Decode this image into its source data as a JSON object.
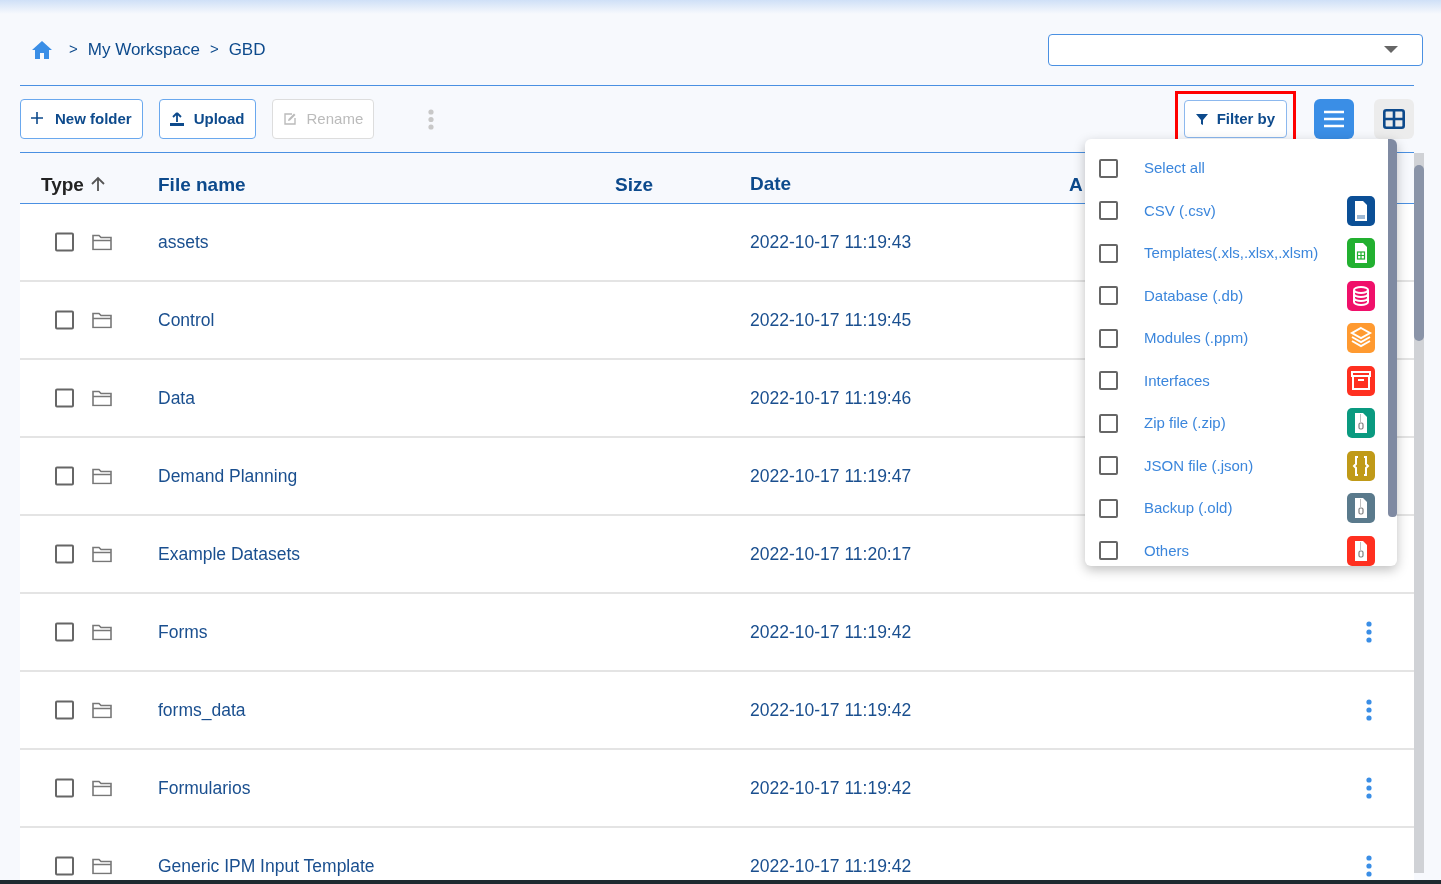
{
  "breadcrumb": [
    "My Workspace",
    "GBD"
  ],
  "breadcrumb_separator": ">",
  "toolbar": {
    "buttons": [
      {
        "label": "New folder",
        "kind": "add",
        "disabled": false
      },
      {
        "label": "Upload",
        "kind": "upload",
        "disabled": false
      },
      {
        "label": "Rename",
        "kind": "rename",
        "disabled": true
      }
    ],
    "filter": {
      "label": "Filter by",
      "highlighted": true
    },
    "views": [
      {
        "kind": "list",
        "selected": true
      },
      {
        "kind": "grid",
        "selected": false
      }
    ]
  },
  "table": {
    "columns": [
      "Type",
      "File name",
      "Size",
      "Date",
      "A"
    ],
    "sort_ascending": true,
    "rows": [
      {
        "name": "assets",
        "date": "2022-10-17 11:19:43",
        "checked": false,
        "menu": false
      },
      {
        "name": "Control",
        "date": "2022-10-17 11:19:45",
        "checked": false,
        "menu": false
      },
      {
        "name": "Data",
        "date": "2022-10-17 11:19:46",
        "checked": false,
        "menu": false
      },
      {
        "name": "Demand Planning",
        "date": "2022-10-17 11:19:47",
        "checked": false,
        "menu": false
      },
      {
        "name": "Example Datasets",
        "date": "2022-10-17 11:20:17",
        "checked": false,
        "menu": false
      },
      {
        "name": "Forms",
        "date": "2022-10-17 11:19:42",
        "checked": false,
        "menu": true
      },
      {
        "name": "forms_data",
        "date": "2022-10-17 11:19:42",
        "checked": false,
        "menu": true
      },
      {
        "name": "Formularios",
        "date": "2022-10-17 11:19:42",
        "checked": false,
        "menu": true
      },
      {
        "name": "Generic IPM Input Template",
        "date": "2022-10-17 11:19:42",
        "checked": false,
        "menu": true
      }
    ]
  },
  "filter_menu": {
    "items": [
      {
        "label": "Select all",
        "kind": "all",
        "checked": false
      },
      {
        "label": "CSV (.csv)",
        "kind": "csv",
        "color": "#0b4f96",
        "checked": false
      },
      {
        "label": "Templates(.xls,.xlsx,.xlsm)",
        "kind": "sheet",
        "color": "#22b030",
        "checked": false
      },
      {
        "label": "Database (.db)",
        "kind": "database",
        "color": "#f0106a",
        "checked": false
      },
      {
        "label": "Modules (.ppm)",
        "kind": "layers",
        "color": "#ff9a30",
        "checked": false
      },
      {
        "label": "Interfaces",
        "kind": "archive",
        "color": "#ff3020",
        "checked": false
      },
      {
        "label": "Zip file (.zip)",
        "kind": "zip",
        "color": "#0a9a80",
        "checked": false
      },
      {
        "label": "JSON file (.json)",
        "kind": "json",
        "color": "#c09a18",
        "checked": false
      },
      {
        "label": "Backup (.old)",
        "kind": "zip",
        "color": "#5a7a8c",
        "checked": false
      },
      {
        "label": "Others",
        "kind": "zip",
        "color": "#ff3020",
        "checked": false
      }
    ]
  }
}
